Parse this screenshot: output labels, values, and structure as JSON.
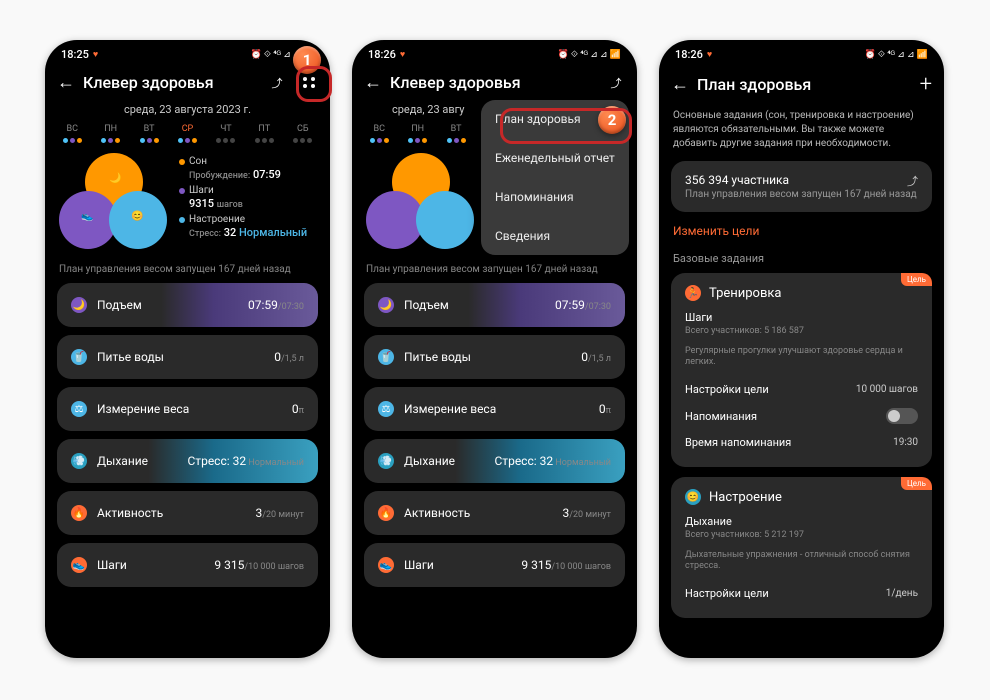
{
  "badges": {
    "one": "1",
    "two": "2"
  },
  "screen1": {
    "status": {
      "time": "18:25",
      "right": "⏰ ⟐ ⁴ᴳ ⊿ ⊿ 📶"
    },
    "title": "Клевер здоровья",
    "date": "среда, 23 августа 2023 г.",
    "days": [
      "ВС",
      "ПН",
      "ВТ",
      "СР",
      "ЧТ",
      "ПТ",
      "СБ"
    ],
    "activeDay": 3,
    "stats": {
      "sleep_label": "Сон",
      "sleep_wake": "Пробуждение:",
      "sleep_time": "07:59",
      "steps_label": "Шаги",
      "steps_count": "9315",
      "steps_unit": "шагов",
      "mood_label": "Настроение",
      "mood_stress": "Стресс:",
      "mood_val": "32",
      "mood_level": "Нормальный"
    },
    "note": "План управления весом запущен 167 дней назад",
    "cards": [
      {
        "icon": "🌙",
        "iconBg": "#7e57c2",
        "title": "Подъем",
        "value": "07:59",
        "sub": "/07:30",
        "grad": "wakeup"
      },
      {
        "icon": "🥤",
        "iconBg": "#4db6e6",
        "title": "Питье воды",
        "value": "0",
        "sub": "/1,5 л"
      },
      {
        "icon": "⚖",
        "iconBg": "#4db6e6",
        "title": "Измерение веса",
        "value": "0",
        "sub": "π"
      },
      {
        "icon": "💨",
        "iconBg": "#2aa0c0",
        "title": "Дыхание",
        "value": "Стресс: 32",
        "sub": " Нормальный",
        "grad": "breath"
      },
      {
        "icon": "🔥",
        "iconBg": "#ff6b35",
        "title": "Активность",
        "value": "3",
        "sub": "/20 минут"
      },
      {
        "icon": "👟",
        "iconBg": "#ff6b35",
        "title": "Шаги",
        "value": "9 315",
        "sub": "/10 000 шагов"
      }
    ]
  },
  "screen2": {
    "status": {
      "time": "18:26"
    },
    "date_partial": "среда, 23 авгу",
    "menu": [
      "План здоровья",
      "Еженедельный отчет",
      "Напоминания",
      "Сведения"
    ]
  },
  "screen3": {
    "status": {
      "time": "18:26"
    },
    "title": "План здоровья",
    "desc": "Основные задания (сон, тренировка и настроение) являются обязательными. Вы также можете добавить другие задания при необходимости.",
    "box": {
      "count": "356 394 участника",
      "sub": "План управления весом запущен 167 дней назад"
    },
    "change_goals": "Изменить цели",
    "section": "Базовые задания",
    "workout": {
      "tag": "Цель",
      "title": "Тренировка",
      "sub": "Шаги",
      "participants": "Всего участников: 5 186 587",
      "hint": "Регулярные прогулки улучшают здоровье сердца и легких.",
      "goal_label": "Настройки цели",
      "goal_val": "10 000 шагов",
      "remind_label": "Напоминания",
      "remind_time_label": "Время напоминания",
      "remind_time_val": "19:30"
    },
    "mood": {
      "tag": "Цель",
      "title": "Настроение",
      "sub": "Дыхание",
      "participants": "Всего участников: 5 212 197",
      "hint": "Дыхательные упражнения - отличный способ снятия стресса.",
      "goal_label": "Настройки цели",
      "goal_val": "1/день"
    }
  }
}
